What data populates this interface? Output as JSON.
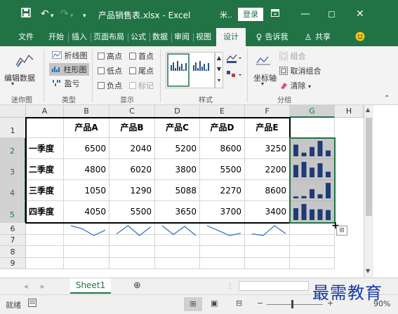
{
  "window": {
    "title": "产品销售表.xlsx - Excel",
    "shortcut": "米..",
    "login_label": "登录",
    "icons": [
      "save-icon",
      "undo-icon",
      "redo-icon",
      "customize-icon",
      "restore-ribbon-icon",
      "minimize-icon",
      "maximize-icon",
      "close-icon"
    ]
  },
  "tabs": [
    "文件",
    "开始",
    "插入",
    "页面布局",
    "公式",
    "数据",
    "审阅",
    "视图",
    "设计"
  ],
  "tell_me": "告诉我",
  "share": "共享",
  "ribbon": {
    "edit_data": "编辑数据",
    "line": "折线图",
    "column": "柱形图",
    "winloss": "盈亏",
    "high": "高点",
    "low": "低点",
    "negative": "负点",
    "first": "首点",
    "last": "尾点",
    "marker": "标记",
    "axis": "坐标轴",
    "group": "组合",
    "ungroup": "取消组合",
    "clear": "清除",
    "groups": [
      "迷你图",
      "类型",
      "显示",
      "样式",
      "分组"
    ]
  },
  "sheet": {
    "columns": [
      "A",
      "B",
      "C",
      "D",
      "E",
      "F",
      "G",
      "H"
    ],
    "rows": [
      "1",
      "2",
      "3",
      "4",
      "5",
      "6",
      "7",
      "8",
      "9"
    ],
    "headers": [
      "产品A",
      "产品B",
      "产品C",
      "产品D",
      "产品E"
    ],
    "data": [
      {
        "label": "一季度",
        "values": [
          "6500",
          "2040",
          "5200",
          "8600",
          "3250"
        ]
      },
      {
        "label": "二季度",
        "values": [
          "4800",
          "6020",
          "3800",
          "5500",
          "2200"
        ]
      },
      {
        "label": "三季度",
        "values": [
          "1050",
          "1290",
          "5088",
          "2270",
          "8600"
        ]
      },
      {
        "label": "四季度",
        "values": [
          "4050",
          "5500",
          "3650",
          "3700",
          "3400"
        ]
      }
    ]
  },
  "sheet_tab": "Sheet1",
  "status": {
    "ready": "就绪",
    "zoom": "90%"
  },
  "watermark": "最需教育"
}
